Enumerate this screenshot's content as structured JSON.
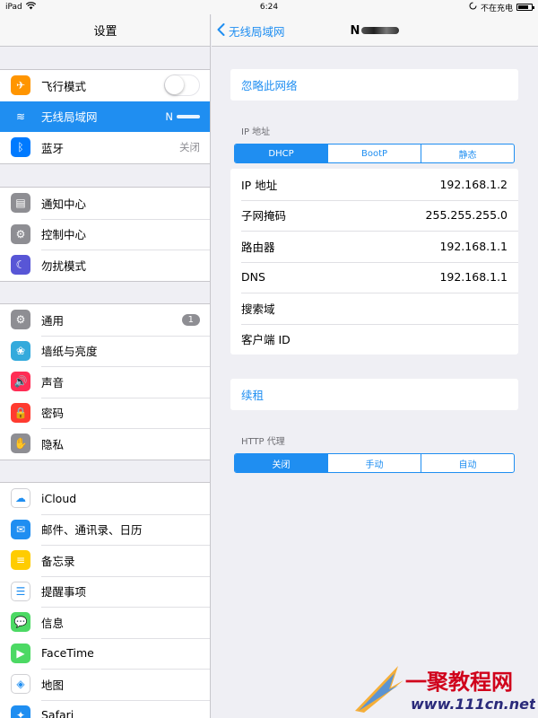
{
  "status_bar": {
    "device": "iPad",
    "time": "6:24",
    "charging": "不在充电",
    "battery_level": 0.8
  },
  "sidebar": {
    "title": "设置",
    "groups": [
      [
        {
          "label": "飞行模式",
          "icon": "airplane-icon",
          "color": "#ff9500",
          "toggle": false
        },
        {
          "label": "无线局域网",
          "icon": "wifi-icon",
          "color": "#1f8ef1",
          "value": "N",
          "selected": true
        },
        {
          "label": "蓝牙",
          "icon": "bluetooth-icon",
          "color": "#007aff",
          "value": "关闭"
        }
      ],
      [
        {
          "label": "通知中心",
          "icon": "notification-icon",
          "color": "#8e8e93"
        },
        {
          "label": "控制中心",
          "icon": "control-center-icon",
          "color": "#8e8e93"
        },
        {
          "label": "勿扰模式",
          "icon": "moon-icon",
          "color": "#5856d6"
        }
      ],
      [
        {
          "label": "通用",
          "icon": "gear-icon",
          "color": "#8e8e93",
          "badge": "1"
        },
        {
          "label": "墙纸与亮度",
          "icon": "flower-icon",
          "color": "#34aadc"
        },
        {
          "label": "声音",
          "icon": "speaker-icon",
          "color": "#ff2d55"
        },
        {
          "label": "密码",
          "icon": "lock-icon",
          "color": "#ff3b30"
        },
        {
          "label": "隐私",
          "icon": "hand-icon",
          "color": "#8e8e93"
        }
      ],
      [
        {
          "label": "iCloud",
          "icon": "cloud-icon",
          "color": "#ffffff"
        },
        {
          "label": "邮件、通讯录、日历",
          "icon": "mail-icon",
          "color": "#1f8ef1"
        },
        {
          "label": "备忘录",
          "icon": "notes-icon",
          "color": "#ffcc00"
        },
        {
          "label": "提醒事项",
          "icon": "reminders-icon",
          "color": "#ffffff"
        },
        {
          "label": "信息",
          "icon": "messages-icon",
          "color": "#4cd964"
        },
        {
          "label": "FaceTime",
          "icon": "facetime-icon",
          "color": "#4cd964"
        },
        {
          "label": "地图",
          "icon": "maps-icon",
          "color": "#ffffff"
        },
        {
          "label": "Safari",
          "icon": "safari-icon",
          "color": "#1f8ef1"
        }
      ]
    ]
  },
  "detail": {
    "back_label": "无线局域网",
    "title": "N",
    "forget_label": "忽略此网络",
    "ip_section_label": "IP 地址",
    "ip_modes": [
      "DHCP",
      "BootP",
      "静态"
    ],
    "ip_rows": [
      {
        "label": "IP 地址",
        "value": "192.168.1.2"
      },
      {
        "label": "子网掩码",
        "value": "255.255.255.0"
      },
      {
        "label": "路由器",
        "value": "192.168.1.1"
      },
      {
        "label": "DNS",
        "value": "192.168.1.1"
      },
      {
        "label": "搜索域",
        "value": ""
      },
      {
        "label": "客户端 ID",
        "value": ""
      }
    ],
    "renew_label": "续租",
    "proxy_section_label": "HTTP 代理",
    "proxy_modes": [
      "关闭",
      "手动",
      "自动"
    ]
  },
  "watermark": {
    "text": "一聚教程网",
    "url": "www.111cn.net",
    "color": "#d0021b"
  }
}
